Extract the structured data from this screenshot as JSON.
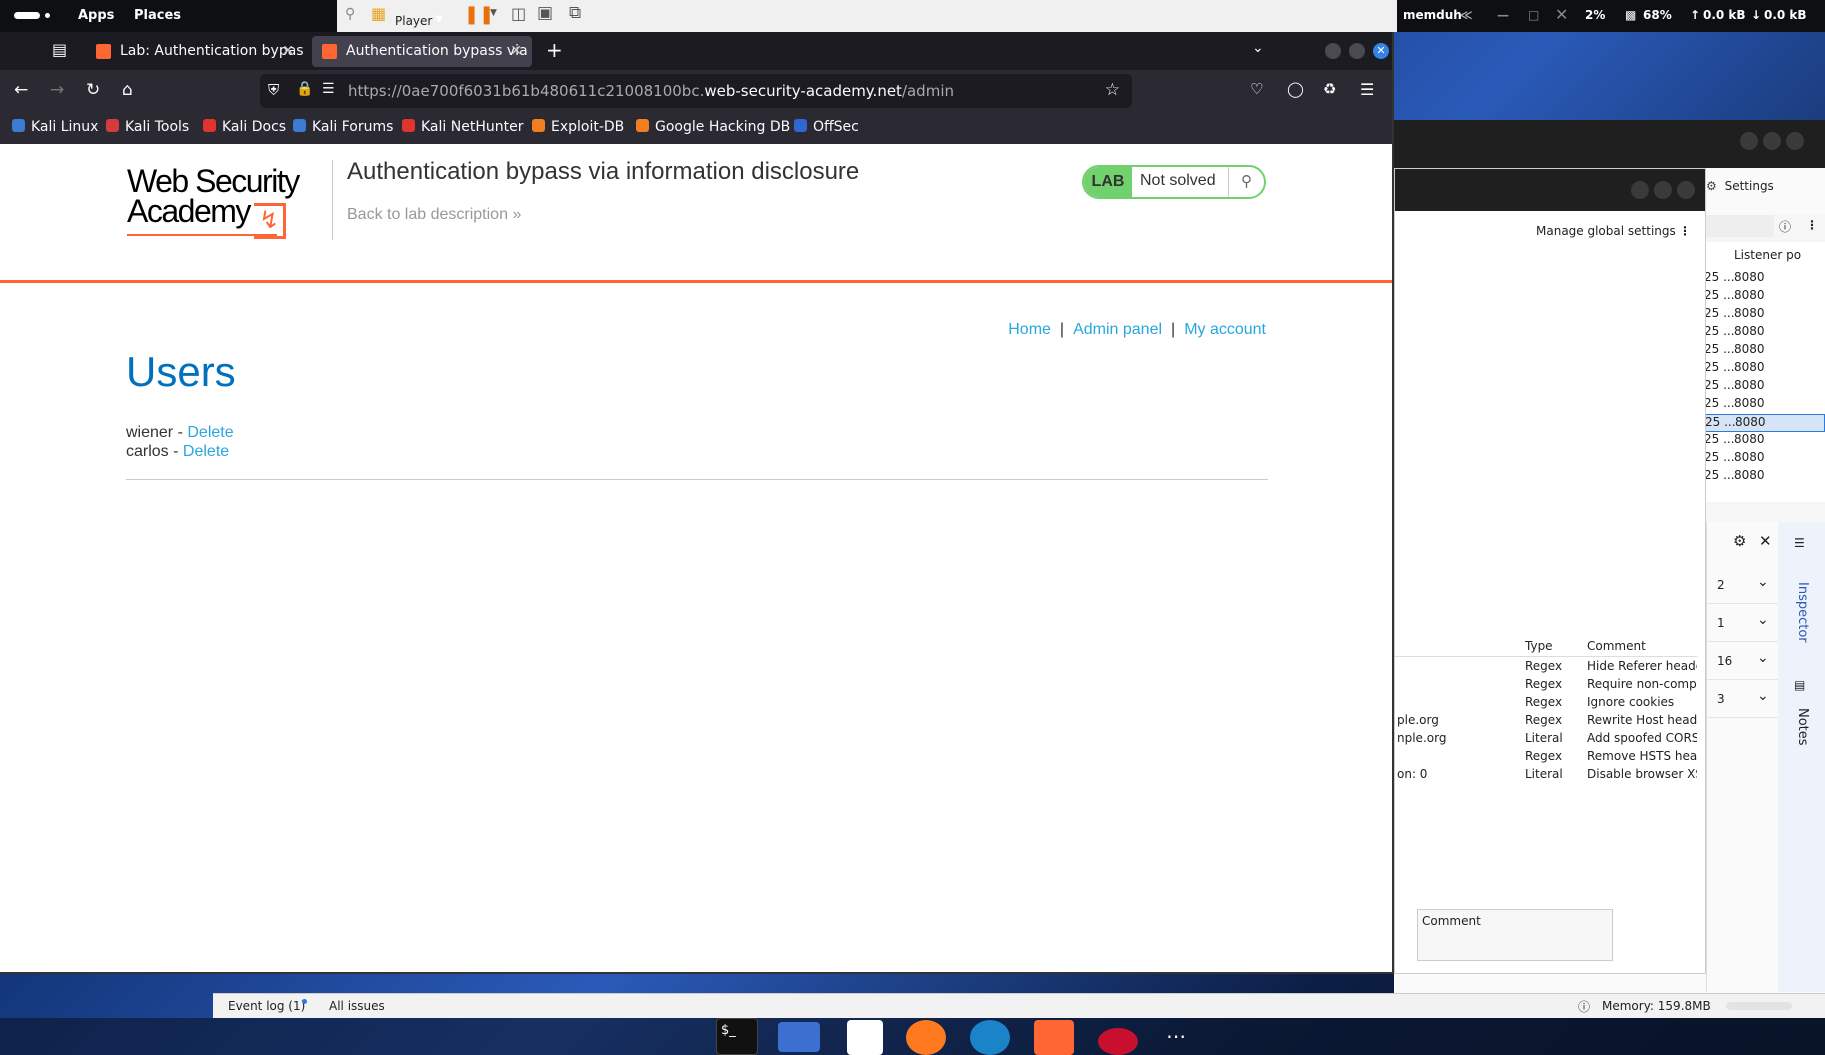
{
  "top_panel": {
    "menus": [
      "Apps",
      "Places"
    ],
    "player_label": "Player",
    "user": "memduh",
    "cpu": "2%",
    "battery": "68%",
    "upload": "0.0 kB",
    "download": "0.0 kB"
  },
  "browser": {
    "tabs": [
      {
        "label": "Lab: Authentication bypas",
        "active": false
      },
      {
        "label": "Authentication bypass via",
        "active": true
      }
    ],
    "url": {
      "prefix": "https://0ae700f6031b61b480611c21008100bc.",
      "domain": "web-security-academy.net",
      "path": "/admin"
    },
    "bookmarks": [
      {
        "label": "Kali Linux",
        "color": "#3c7bd4"
      },
      {
        "label": "Kali Tools",
        "color": "#d43c3c"
      },
      {
        "label": "Kali Docs",
        "color": "#e0352f"
      },
      {
        "label": "Kali Forums",
        "color": "#3c7bd4"
      },
      {
        "label": "Kali NetHunter",
        "color": "#e0352f"
      },
      {
        "label": "Exploit-DB",
        "color": "#f07f1f"
      },
      {
        "label": "Google Hacking DB",
        "color": "#f07f1f"
      },
      {
        "label": "OffSec",
        "color": "#2f66d0"
      }
    ]
  },
  "lab": {
    "logo_line1": "Web Security",
    "logo_line2": "Academy",
    "title": "Authentication bypass via information disclosure",
    "back_link": "Back to lab description",
    "badge": "LAB",
    "status": "Not solved",
    "accent": "#ff6633",
    "status_color": "#70d16d"
  },
  "nav": {
    "home": "Home",
    "admin": "Admin panel",
    "account": "My account",
    "separator": "|"
  },
  "users": {
    "heading": "Users",
    "list": [
      {
        "name": "wiener",
        "sep": " - ",
        "action": "Delete"
      },
      {
        "name": "carlos",
        "sep": " - ",
        "action": "Delete"
      }
    ]
  },
  "burp": {
    "settings": "Settings",
    "manage_global": "Manage global settings",
    "listener_header": "Listener po",
    "listener_ports": [
      "8080",
      "8080",
      "8080",
      "8080",
      "8080",
      "8080",
      "8080",
      "8080",
      "8080",
      "8080",
      "8080",
      "8080"
    ],
    "listener_prefix": "25 ...",
    "inspector": "Inspector",
    "notes": "Notes",
    "inspector_counts": [
      "2",
      "1",
      "16",
      "3"
    ],
    "rules_headers": [
      "Type",
      "Comment"
    ],
    "rules": [
      {
        "match": "",
        "type": "Regex",
        "comment": "Hide Referer heade"
      },
      {
        "match": "",
        "type": "Regex",
        "comment": "Require non-compr"
      },
      {
        "match": "",
        "type": "Regex",
        "comment": "Ignore cookies"
      },
      {
        "match": "ple.org",
        "type": "Regex",
        "comment": "Rewrite Host head"
      },
      {
        "match": "nple.org",
        "type": "Literal",
        "comment": "Add spoofed CORS"
      },
      {
        "match": "",
        "type": "Regex",
        "comment": "Remove HSTS head"
      },
      {
        "match": "on: 0",
        "type": "Literal",
        "comment": "Disable browser XS"
      }
    ],
    "comment_header": "Comment",
    "event_log": "Event log (1)",
    "all_issues": "All issues",
    "memory": "Memory: 159.8MB"
  }
}
